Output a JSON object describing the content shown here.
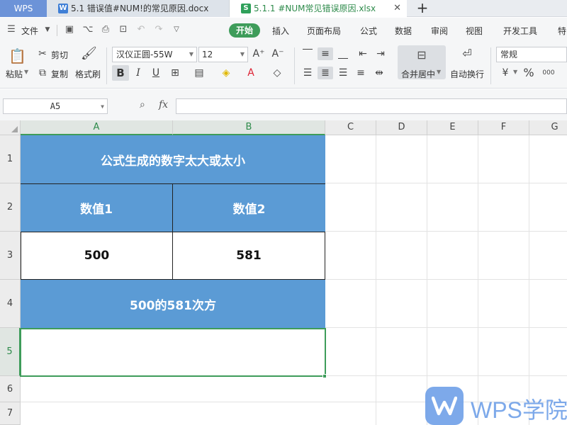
{
  "titlebar": {
    "app_tab": "WPS",
    "tabs": [
      {
        "label": "5.1 错误值#NUM!的常见原因.docx",
        "icon": "word-doc-icon",
        "icon_char": "W"
      },
      {
        "label": "5.1.1 #NUM常见错误原因.xlsx",
        "icon": "sheet-doc-icon",
        "icon_char": "S"
      }
    ],
    "close_char": "✕",
    "new_tab_char": "+"
  },
  "menubar": {
    "file_label": "文件",
    "items": [
      "开始",
      "插入",
      "页面布局",
      "公式",
      "数据",
      "审阅",
      "视图",
      "开发工具",
      "特"
    ]
  },
  "ribbon": {
    "paste_label": "粘贴",
    "cut_label": "剪切",
    "copy_label": "复制",
    "format_painter_label": "格式刷",
    "font_name": "汉仪正圆-55W",
    "font_size": "12",
    "bold_label": "B",
    "italic_label": "I",
    "underline_label": "U",
    "merge_label": "合并居中",
    "wrap_label": "自动换行",
    "number_format": "常规",
    "percent_label": "%",
    "thousands_label": "000"
  },
  "formula_bar": {
    "name_box": "A5",
    "fx_label": "fx",
    "formula": ""
  },
  "grid": {
    "columns": [
      "A",
      "B",
      "C",
      "D",
      "E",
      "F",
      "G"
    ],
    "rows": [
      "1",
      "2",
      "3",
      "4",
      "5",
      "6",
      "7"
    ],
    "selected_cell": "A5",
    "cells": {
      "r1_title": "公式生成的数字太大或太小",
      "r2_a": "数值1",
      "r2_b": "数值2",
      "r3_a": "500",
      "r3_b": "581",
      "r4_merged": "500的581次方",
      "r5_merged": ""
    },
    "colors": {
      "header_fill": "#5b9bd5",
      "selection": "#3e9c5a"
    }
  },
  "watermark": {
    "text": "WPS学院"
  }
}
